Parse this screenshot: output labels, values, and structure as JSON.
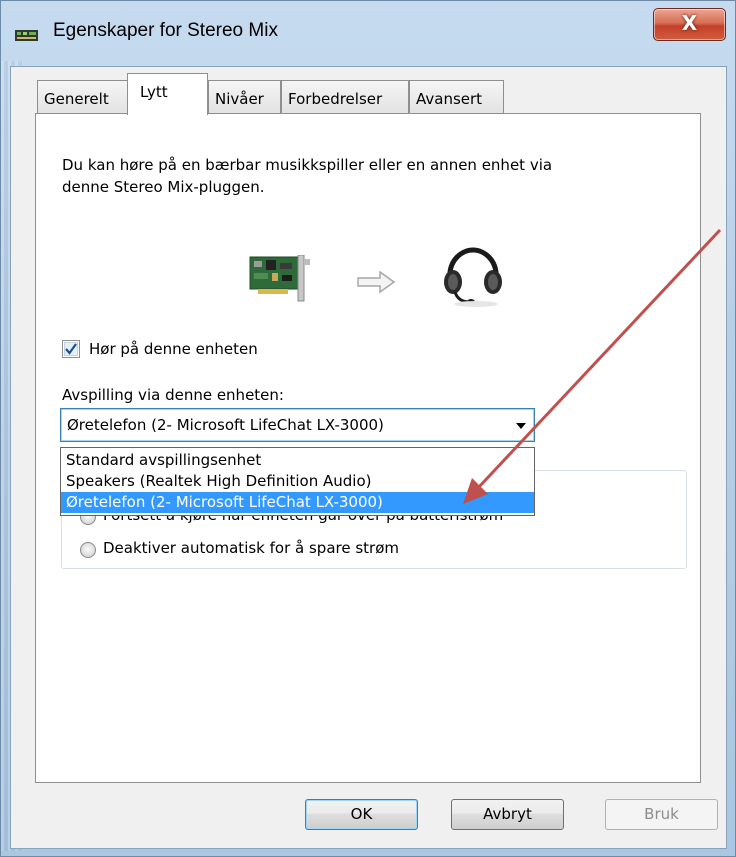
{
  "window": {
    "title": "Egenskaper for Stereo Mix",
    "close_label": "X"
  },
  "tabs": [
    {
      "label": "Generelt",
      "active": false
    },
    {
      "label": "Lytt",
      "active": true
    },
    {
      "label": "Nivåer",
      "active": false
    },
    {
      "label": "Forbedrelser",
      "active": false
    },
    {
      "label": "Avansert",
      "active": false
    }
  ],
  "listen": {
    "description_line1": "Du kan høre på en bærbar musikkspiller eller en annen enhet via",
    "description_line2": "denne Stereo Mix-pluggen.",
    "checkbox_label": "Hør på denne enheten",
    "checkbox_checked": true,
    "playback_label": "Avspilling via denne enheten:",
    "playback_selected": "Øretelefon (2- Microsoft LifeChat LX-3000)",
    "playback_options": [
      "Standard avspillingsenhet",
      "Speakers (Realtek High Definition Audio)",
      "Øretelefon (2- Microsoft LifeChat LX-3000)"
    ],
    "power_options": [
      "Fortsett å kjøre når enheten går over på batteristrøm",
      "Deaktiver automatisk for å spare strøm"
    ]
  },
  "buttons": {
    "ok": "OK",
    "cancel": "Avbryt",
    "apply": "Bruk"
  },
  "icons": [
    "sound-card-icon",
    "arrow-right-icon",
    "headset-icon",
    "speaker-window-icon"
  ],
  "colors": {
    "selection": "#3399ff",
    "close_button": "#c9452e",
    "annotation_arrow": "#c0504d"
  }
}
